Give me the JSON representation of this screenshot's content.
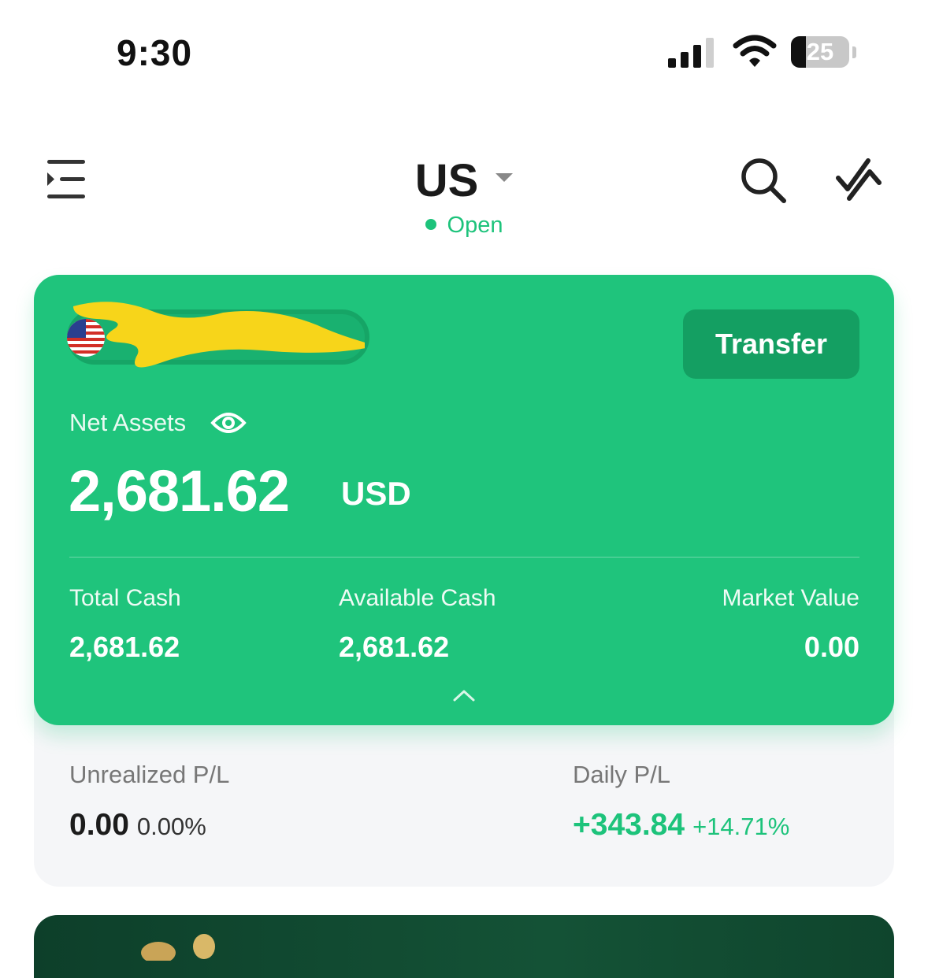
{
  "status_bar": {
    "time": "9:30",
    "battery_percent": "25",
    "battery_level": 0.25,
    "icons": [
      "signal-icon",
      "wifi-icon",
      "battery-icon"
    ]
  },
  "nav": {
    "market": "US",
    "market_status": "Open",
    "icons": [
      "menu-icon",
      "chevron-down-icon",
      "search-icon",
      "trade-icon"
    ]
  },
  "colors": {
    "accent_green": "#1fc47c",
    "button_green": "#149f62",
    "positive": "#1dc37b",
    "redaction_yellow": "#f7d51a"
  },
  "account": {
    "flag_icon": "us-flag-icon",
    "account_name_redacted": true,
    "transfer_label": "Transfer",
    "net_assets_label": "Net Assets",
    "net_assets_value": "2,681.62",
    "currency": "USD",
    "metrics": [
      {
        "label": "Total Cash",
        "value": "2,681.62"
      },
      {
        "label": "Available Cash",
        "value": "2,681.62"
      },
      {
        "label": "Market Value",
        "value": "0.00"
      }
    ]
  },
  "pl": {
    "unrealized_label": "Unrealized P/L",
    "unrealized_value": "0.00",
    "unrealized_pct": "0.00%",
    "daily_label": "Daily P/L",
    "daily_value": "+343.84",
    "daily_pct": "+14.71%"
  }
}
